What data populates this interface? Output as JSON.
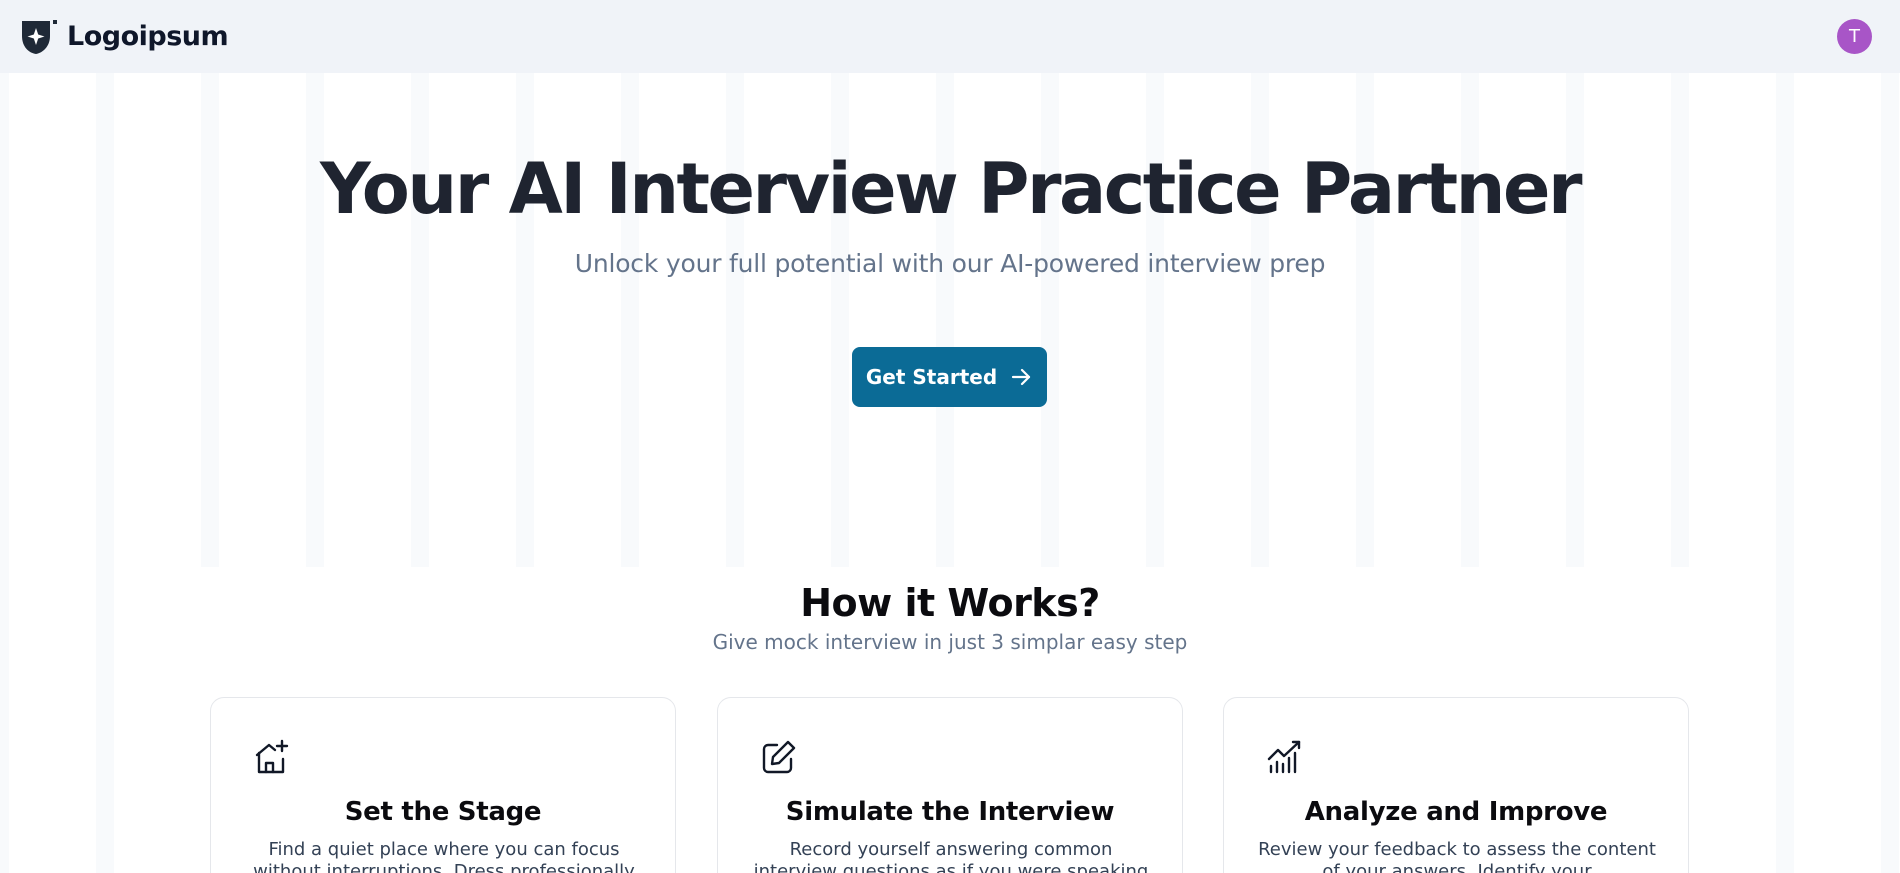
{
  "header": {
    "logo_text": "Logoipsum",
    "avatar_initial": "T",
    "avatar_color": "#a855c7"
  },
  "hero": {
    "title": "Your AI Interview Practice Partner",
    "subtitle": "Unlock your full potential with our AI-powered interview prep",
    "cta_label": "Get Started",
    "cta_icon": "arrow-right-icon",
    "cta_color": "#0b6b96"
  },
  "how_it_works": {
    "title": "How it Works?",
    "subtitle": "Give mock interview in just 3 simplar easy step",
    "cards": [
      {
        "icon": "house-plus-icon",
        "title": "Set the Stage",
        "description": "Find a quiet place where you can focus without interruptions. Dress professionally"
      },
      {
        "icon": "pencil-square-icon",
        "title": "Simulate the Interview",
        "description": "Record yourself answering common interview questions as if you were speaking"
      },
      {
        "icon": "chart-trend-icon",
        "title": "Analyze and Improve",
        "description": "Review your feedback to assess the content of your answers. Identify your"
      }
    ]
  }
}
